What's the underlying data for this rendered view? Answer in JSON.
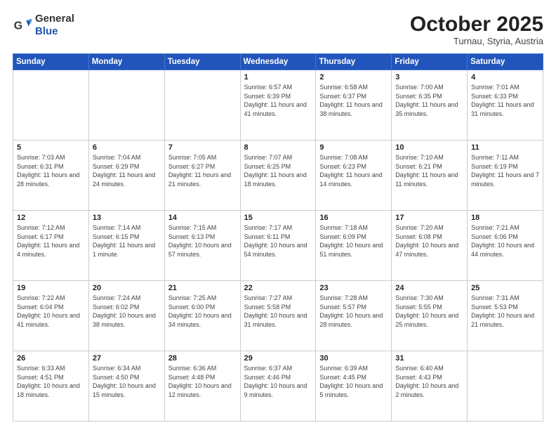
{
  "header": {
    "logo_line1": "General",
    "logo_line2": "Blue",
    "month_title": "October 2025",
    "location": "Turnau, Styria, Austria"
  },
  "weekdays": [
    "Sunday",
    "Monday",
    "Tuesday",
    "Wednesday",
    "Thursday",
    "Friday",
    "Saturday"
  ],
  "weeks": [
    [
      {
        "day": "",
        "info": ""
      },
      {
        "day": "",
        "info": ""
      },
      {
        "day": "",
        "info": ""
      },
      {
        "day": "1",
        "info": "Sunrise: 6:57 AM\nSunset: 6:39 PM\nDaylight: 11 hours\nand 41 minutes."
      },
      {
        "day": "2",
        "info": "Sunrise: 6:58 AM\nSunset: 6:37 PM\nDaylight: 11 hours\nand 38 minutes."
      },
      {
        "day": "3",
        "info": "Sunrise: 7:00 AM\nSunset: 6:35 PM\nDaylight: 11 hours\nand 35 minutes."
      },
      {
        "day": "4",
        "info": "Sunrise: 7:01 AM\nSunset: 6:33 PM\nDaylight: 11 hours\nand 31 minutes."
      }
    ],
    [
      {
        "day": "5",
        "info": "Sunrise: 7:03 AM\nSunset: 6:31 PM\nDaylight: 11 hours\nand 28 minutes."
      },
      {
        "day": "6",
        "info": "Sunrise: 7:04 AM\nSunset: 6:29 PM\nDaylight: 11 hours\nand 24 minutes."
      },
      {
        "day": "7",
        "info": "Sunrise: 7:05 AM\nSunset: 6:27 PM\nDaylight: 11 hours\nand 21 minutes."
      },
      {
        "day": "8",
        "info": "Sunrise: 7:07 AM\nSunset: 6:25 PM\nDaylight: 11 hours\nand 18 minutes."
      },
      {
        "day": "9",
        "info": "Sunrise: 7:08 AM\nSunset: 6:23 PM\nDaylight: 11 hours\nand 14 minutes."
      },
      {
        "day": "10",
        "info": "Sunrise: 7:10 AM\nSunset: 6:21 PM\nDaylight: 11 hours\nand 11 minutes."
      },
      {
        "day": "11",
        "info": "Sunrise: 7:11 AM\nSunset: 6:19 PM\nDaylight: 11 hours\nand 7 minutes."
      }
    ],
    [
      {
        "day": "12",
        "info": "Sunrise: 7:12 AM\nSunset: 6:17 PM\nDaylight: 11 hours\nand 4 minutes."
      },
      {
        "day": "13",
        "info": "Sunrise: 7:14 AM\nSunset: 6:15 PM\nDaylight: 11 hours\nand 1 minute."
      },
      {
        "day": "14",
        "info": "Sunrise: 7:15 AM\nSunset: 6:13 PM\nDaylight: 10 hours\nand 57 minutes."
      },
      {
        "day": "15",
        "info": "Sunrise: 7:17 AM\nSunset: 6:11 PM\nDaylight: 10 hours\nand 54 minutes."
      },
      {
        "day": "16",
        "info": "Sunrise: 7:18 AM\nSunset: 6:09 PM\nDaylight: 10 hours\nand 51 minutes."
      },
      {
        "day": "17",
        "info": "Sunrise: 7:20 AM\nSunset: 6:08 PM\nDaylight: 10 hours\nand 47 minutes."
      },
      {
        "day": "18",
        "info": "Sunrise: 7:21 AM\nSunset: 6:06 PM\nDaylight: 10 hours\nand 44 minutes."
      }
    ],
    [
      {
        "day": "19",
        "info": "Sunrise: 7:22 AM\nSunset: 6:04 PM\nDaylight: 10 hours\nand 41 minutes."
      },
      {
        "day": "20",
        "info": "Sunrise: 7:24 AM\nSunset: 6:02 PM\nDaylight: 10 hours\nand 38 minutes."
      },
      {
        "day": "21",
        "info": "Sunrise: 7:25 AM\nSunset: 6:00 PM\nDaylight: 10 hours\nand 34 minutes."
      },
      {
        "day": "22",
        "info": "Sunrise: 7:27 AM\nSunset: 5:58 PM\nDaylight: 10 hours\nand 31 minutes."
      },
      {
        "day": "23",
        "info": "Sunrise: 7:28 AM\nSunset: 5:57 PM\nDaylight: 10 hours\nand 28 minutes."
      },
      {
        "day": "24",
        "info": "Sunrise: 7:30 AM\nSunset: 5:55 PM\nDaylight: 10 hours\nand 25 minutes."
      },
      {
        "day": "25",
        "info": "Sunrise: 7:31 AM\nSunset: 5:53 PM\nDaylight: 10 hours\nand 21 minutes."
      }
    ],
    [
      {
        "day": "26",
        "info": "Sunrise: 6:33 AM\nSunset: 4:51 PM\nDaylight: 10 hours\nand 18 minutes."
      },
      {
        "day": "27",
        "info": "Sunrise: 6:34 AM\nSunset: 4:50 PM\nDaylight: 10 hours\nand 15 minutes."
      },
      {
        "day": "28",
        "info": "Sunrise: 6:36 AM\nSunset: 4:48 PM\nDaylight: 10 hours\nand 12 minutes."
      },
      {
        "day": "29",
        "info": "Sunrise: 6:37 AM\nSunset: 4:46 PM\nDaylight: 10 hours\nand 9 minutes."
      },
      {
        "day": "30",
        "info": "Sunrise: 6:39 AM\nSunset: 4:45 PM\nDaylight: 10 hours\nand 5 minutes."
      },
      {
        "day": "31",
        "info": "Sunrise: 6:40 AM\nSunset: 4:43 PM\nDaylight: 10 hours\nand 2 minutes."
      },
      {
        "day": "",
        "info": ""
      }
    ]
  ]
}
